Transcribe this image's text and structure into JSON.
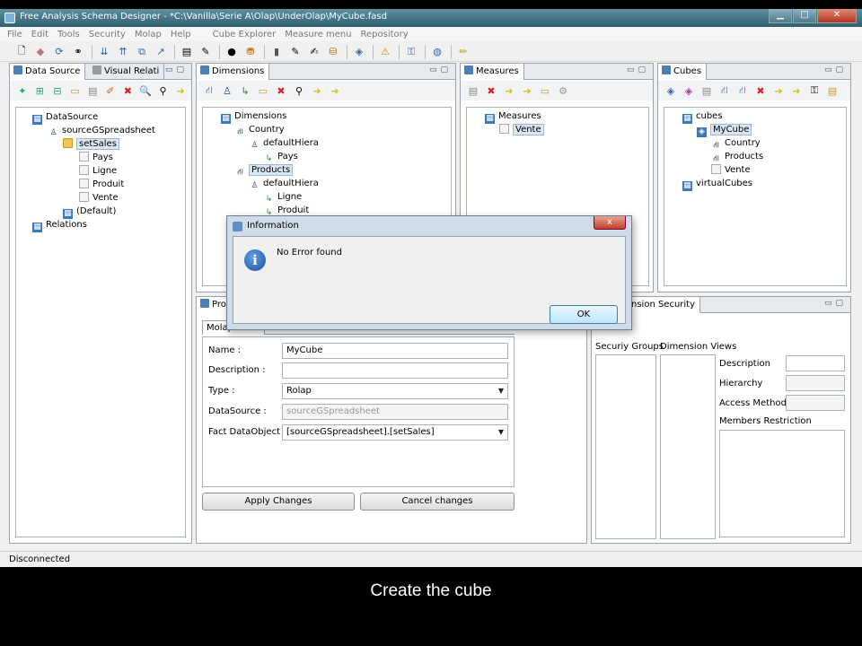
{
  "window": {
    "title": "Free Analysis Schema Designer - *C:\\Vanilla\\Serie A\\Olap\\UnderOlap\\MyCube.fasd"
  },
  "menu": [
    "File",
    "Edit",
    "Tools",
    "Security",
    "Molap",
    "Help",
    "Cube Explorer",
    "Measure menu",
    "Repository"
  ],
  "panels": {
    "datasource": {
      "tabs": [
        "Data Source",
        "Visual Relati"
      ],
      "tree": [
        "DataSource",
        "sourceGSpreadsheet",
        "setSales",
        "Pays",
        "Ligne",
        "Produit",
        "Vente",
        "(Default)",
        "Relations"
      ]
    },
    "dimensions": {
      "tab": "Dimensions",
      "tree": [
        "Dimensions",
        "Country",
        "defaultHiera",
        "Pays",
        "Products",
        "defaultHiera",
        "Ligne",
        "Produit"
      ]
    },
    "measures": {
      "tab": "Measures",
      "tree": [
        "Measures",
        "Vente"
      ]
    },
    "cubes": {
      "tab": "Cubes",
      "tree": [
        "cubes",
        "MyCube",
        "Country",
        "Products",
        "Vente",
        "virtualCubes"
      ]
    },
    "properties": {
      "tab": "Pro",
      "subtab": "Molap Links",
      "fields": {
        "name_label": "Name :",
        "name_value": "MyCube",
        "description_label": "Description :",
        "description_value": "",
        "type_label": "Type :",
        "type_value": "Rolap",
        "datasource_label": "DataSource :",
        "datasource_value": "sourceGSpreadsheet",
        "fact_label": "Fact DataObject :",
        "fact_value": "[sourceGSpreadsheet].[setSales]"
      },
      "apply_label": "Apply Changes",
      "cancel_label": "Cancel changes"
    },
    "security": {
      "tab": "nsion Security",
      "groups_label": "Securiy Groups",
      "views_label": "Dimension Views",
      "description_label": "Description",
      "hierarchy_label": "Hierarchy",
      "access_label": "Access Method",
      "members_label": "Members Restriction"
    }
  },
  "dialog": {
    "title": "Information",
    "message": "No Error found",
    "ok_label": "OK",
    "close_label": "x"
  },
  "status": "Disconnected",
  "caption": "Create the cube"
}
